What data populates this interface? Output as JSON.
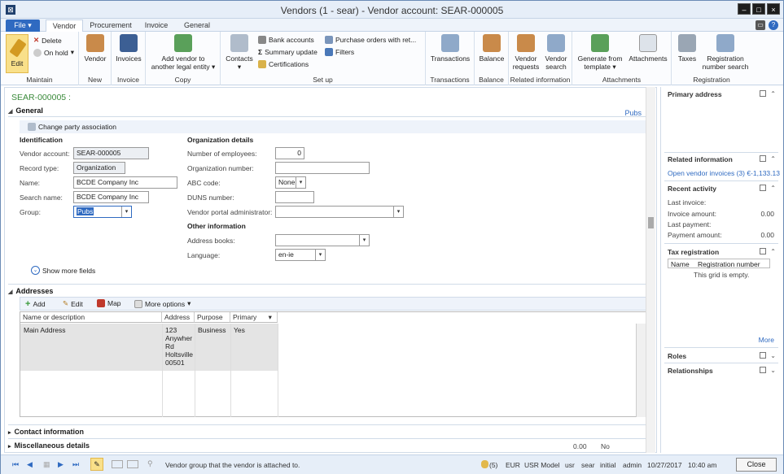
{
  "window": {
    "title": "Vendors (1 - sear) - Vendor account: SEAR-000005"
  },
  "tabs": [
    "File",
    "Vendor",
    "Procurement",
    "Invoice",
    "General"
  ],
  "ribbon": {
    "maintain": {
      "label": "Maintain",
      "edit": "Edit",
      "delete": "Delete",
      "on_hold": "On hold"
    },
    "new": {
      "label": "New",
      "vendor": "Vendor"
    },
    "invoice": {
      "label": "Invoice",
      "invoices": "Invoices"
    },
    "copy": {
      "label": "Copy",
      "add_vendor": "Add vendor to",
      "add_vendor2": "another legal entity"
    },
    "setup": {
      "label": "Set up",
      "contacts": "Contacts",
      "bank_accounts": "Bank accounts",
      "summary_update": "Summary update",
      "certifications": "Certifications",
      "purchase_orders": "Purchase orders with ret...",
      "filters": "Filters"
    },
    "transactions": {
      "label": "Transactions",
      "transactions": "Transactions"
    },
    "balance": {
      "label": "Balance",
      "balance": "Balance"
    },
    "related": {
      "label": "Related information",
      "vendor_requests": "Vendor",
      "vendor_requests2": "requests",
      "vendor_search": "Vendor",
      "vendor_search2": "search"
    },
    "attachments": {
      "label": "Attachments",
      "generate": "Generate from",
      "generate2": "template",
      "attachments": "Attachments"
    },
    "registration": {
      "label": "Registration",
      "taxes": "Taxes",
      "regnum": "Registration",
      "regnum2": "number search"
    }
  },
  "record": {
    "id": "SEAR-000005 :"
  },
  "general": {
    "title": "General",
    "pubs": "Pubs",
    "change_party": "Change party association",
    "identification": "Identification",
    "vendor_account_label": "Vendor account:",
    "vendor_account": "SEAR-000005",
    "record_type_label": "Record type:",
    "record_type": "Organization",
    "name_label": "Name:",
    "name": "BCDE Company Inc",
    "search_name_label": "Search name:",
    "search_name": "BCDE Company Inc",
    "group_label": "Group:",
    "group": "Pubs",
    "org_details": "Organization details",
    "employees_label": "Number of employees:",
    "employees": "0",
    "org_number_label": "Organization number:",
    "abc_label": "ABC code:",
    "abc": "None",
    "duns_label": "DUNS number:",
    "portal_admin_label": "Vendor portal administrator:",
    "other_info": "Other information",
    "address_books_label": "Address books:",
    "language_label": "Language:",
    "language": "en-ie",
    "show_more": "Show more fields"
  },
  "addresses": {
    "title": "Addresses",
    "add": "Add",
    "edit": "Edit",
    "map": "Map",
    "more": "More options",
    "columns": [
      "Name or description",
      "Address",
      "Purpose",
      "Primary"
    ],
    "row": {
      "name": "Main Address",
      "address": [
        "123",
        "Anywher",
        "Rd",
        "Holtsville",
        "00501"
      ],
      "purpose": "Business",
      "primary": "Yes"
    }
  },
  "collapsed": {
    "contact": "Contact information",
    "misc": "Miscellaneous details",
    "misc_amount": "0.00",
    "misc_no": "No"
  },
  "factbox": {
    "primary_address": "Primary address",
    "related_info": "Related information",
    "open_invoices": "Open vendor invoices (3) €-1,133.13",
    "recent_activity": "Recent activity",
    "last_invoice": "Last invoice:",
    "invoice_amount": "Invoice amount:",
    "invoice_amount_val": "0.00",
    "last_payment": "Last payment:",
    "payment_amount": "Payment amount:",
    "payment_amount_val": "0.00",
    "tax_registration": "Tax registration",
    "tax_cols": [
      "Name",
      "Registration number"
    ],
    "empty": "This grid is empty.",
    "more": "More",
    "roles": "Roles",
    "relationships": "Relationships"
  },
  "status": {
    "help": "Vendor group that the vendor is attached to.",
    "alerts": "(5)",
    "currency": "EUR",
    "model": "USR Model",
    "layer": "usr",
    "company": "sear",
    "partition": "initial",
    "user": "admin",
    "date": "10/27/2017",
    "time": "10:40 am",
    "close": "Close"
  }
}
